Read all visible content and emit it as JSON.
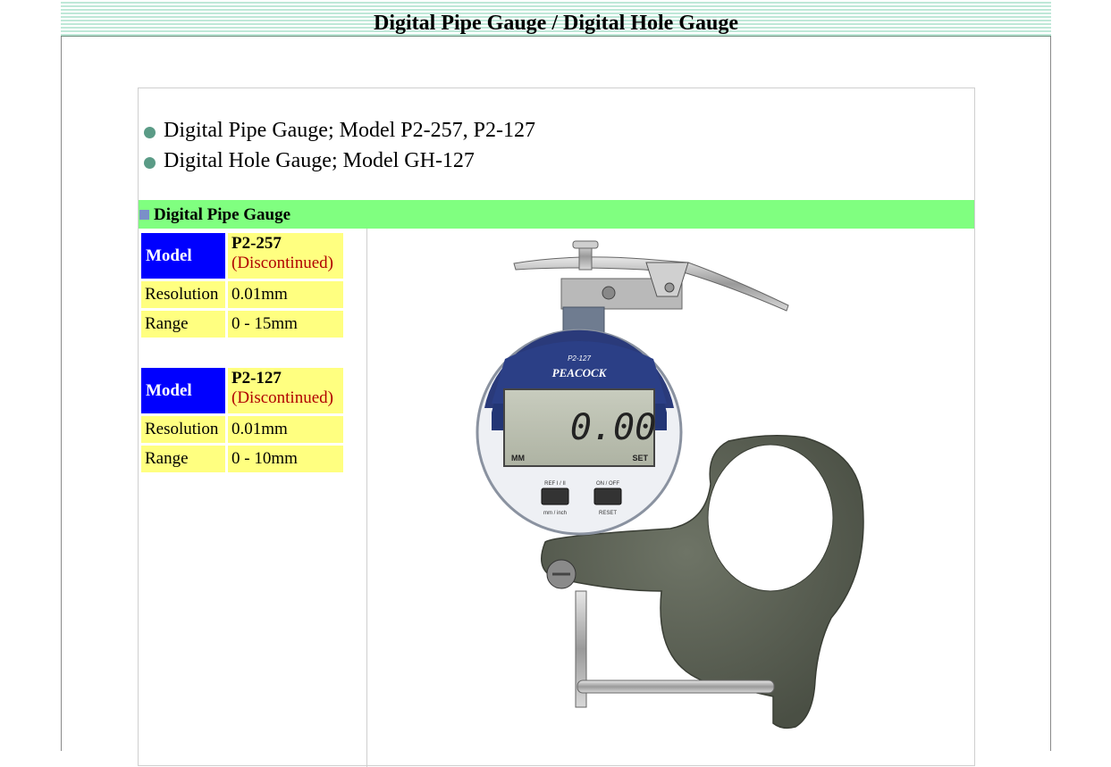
{
  "page": {
    "title": "Digital Pipe Gauge / Digital Hole Gauge"
  },
  "bullets": [
    "Digital Pipe Gauge;  Model P2-257, P2-127",
    "Digital Hole Gauge; Model GH-127"
  ],
  "section": {
    "title": "Digital Pipe Gauge"
  },
  "specs": [
    {
      "model_label": "Model",
      "model_name": "P2-257",
      "status": "(Discontinued)",
      "resolution_label": "Resolution",
      "resolution_value": "0.01mm",
      "range_label": "Range",
      "range_value": "0 - 15mm"
    },
    {
      "model_label": "Model",
      "model_name": "P2-127",
      "status": "(Discontinued)",
      "resolution_label": "Resolution",
      "resolution_value": "0.01mm",
      "range_label": "Range",
      "range_value": "0 - 10mm"
    }
  ],
  "product_image": {
    "model_text": "P2-127",
    "brand": "PEACOCK",
    "display": "0.00",
    "unit_left": "MM",
    "unit_right": "SET",
    "btn_left_top": "REF I / II",
    "btn_left_bottom": "mm / inch",
    "btn_right_top": "ON / OFF",
    "btn_right_bottom": "RESET"
  },
  "colors": {
    "header_stripe": "#bfe8d8",
    "section_bar": "#80ff80",
    "model_cell": "#0000ff",
    "value_cell": "#ffff80",
    "discontinued": "#b00000",
    "bullet": "#5a9b86"
  }
}
